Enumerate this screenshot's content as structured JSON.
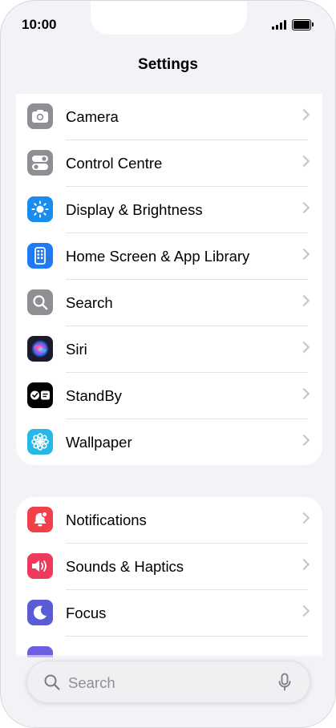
{
  "status_bar": {
    "time": "10:00"
  },
  "header": {
    "title": "Settings"
  },
  "group1": {
    "items": [
      {
        "label": "Camera",
        "icon": "camera-icon",
        "color": "#8e8e93"
      },
      {
        "label": "Control Centre",
        "icon": "toggles-icon",
        "color": "#8e8e93"
      },
      {
        "label": "Display & Brightness",
        "icon": "sun-icon",
        "color": "#1a8cf0"
      },
      {
        "label": "Home Screen & App Library",
        "icon": "home-screen-icon",
        "color": "#1e7bf5"
      },
      {
        "label": "Search",
        "icon": "search-icon",
        "color": "#8e8e93"
      },
      {
        "label": "Siri",
        "icon": "siri-icon",
        "color": "#1b1b2e"
      },
      {
        "label": "StandBy",
        "icon": "standby-icon",
        "color": "#000000"
      },
      {
        "label": "Wallpaper",
        "icon": "flower-icon",
        "color": "#28b8e8"
      }
    ]
  },
  "group2": {
    "items": [
      {
        "label": "Notifications",
        "icon": "bell-icon",
        "color": "#f0404a"
      },
      {
        "label": "Sounds & Haptics",
        "icon": "speaker-icon",
        "color": "#f03a5c"
      },
      {
        "label": "Focus",
        "icon": "moon-icon",
        "color": "#5b5bd6"
      }
    ]
  },
  "search": {
    "placeholder": "Search"
  }
}
